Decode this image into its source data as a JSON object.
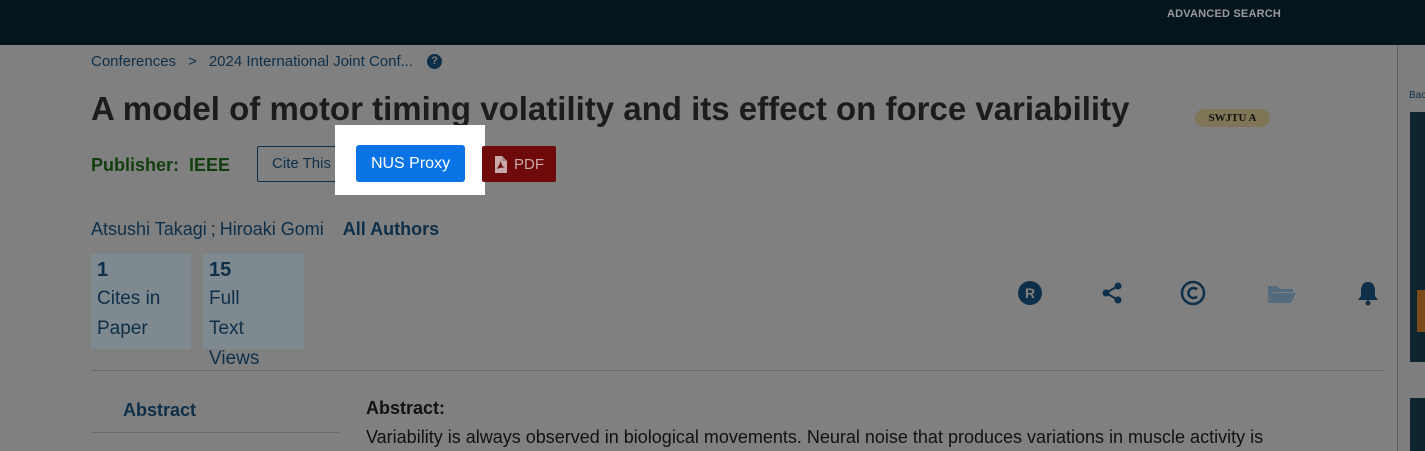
{
  "header": {
    "advanced_search": "ADVANCED SEARCH"
  },
  "breadcrumb": {
    "item1": "Conferences",
    "separator": ">",
    "item2": "2024 International Joint Conf...",
    "help_icon": "question-circle-icon"
  },
  "article": {
    "title": "A model of motor timing volatility and its effect on force variability",
    "badge": "SWJTU A",
    "publisher_label": "Publisher:",
    "publisher_name": "IEEE"
  },
  "actions": {
    "cite_label": "Cite This",
    "nus_label": "NUS Proxy",
    "pdf_label": "PDF"
  },
  "authors": {
    "author1": "Atsushi Takagi",
    "separator": ";",
    "author2": "Hiroaki Gomi",
    "all_authors": "All Authors"
  },
  "metrics": {
    "cites_count": "1",
    "cites_label": "Cites in Paper",
    "views_count": "15",
    "views_label": "Full Text Views"
  },
  "tools": [
    "rights-r-icon",
    "share-icon",
    "copyright-icon",
    "folder-icon",
    "bell-icon"
  ],
  "abstract": {
    "tab_label": "Abstract",
    "heading": "Abstract:",
    "text": "Variability is always observed in biological movements. Neural noise that produces variations in muscle activity is"
  },
  "side_panel": {
    "label": "Bac"
  },
  "colors": {
    "nus_button": "#0a74e6",
    "pdf_button": "#6e0a0a",
    "badge": "#7f7557",
    "topbar": "#04151e"
  }
}
